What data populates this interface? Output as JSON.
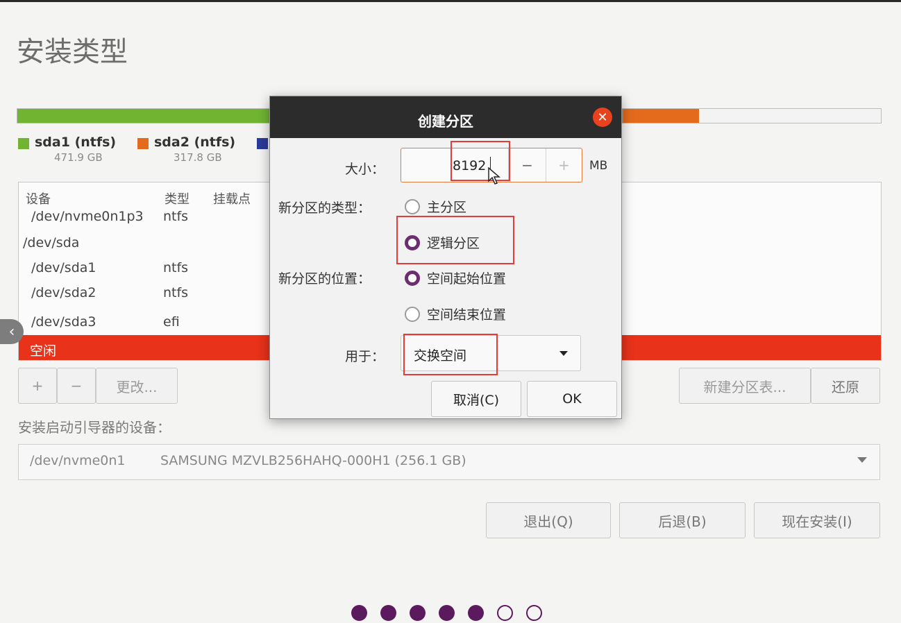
{
  "page": {
    "title": "安装类型"
  },
  "legend": [
    {
      "name": "sda1 (ntfs)",
      "size": "471.9 GB",
      "color": "#71b432"
    },
    {
      "name": "sda2 (ntfs)",
      "size": "317.8 GB",
      "color": "#e46a1c"
    },
    {
      "color": "#2b3b9a"
    }
  ],
  "table": {
    "headers": [
      "设备",
      "类型",
      "挂载点"
    ],
    "rows": [
      {
        "device": "/dev/nvme0n1p3",
        "type": "ntfs"
      },
      {
        "device": "/dev/sda",
        "type": ""
      },
      {
        "device": "/dev/sda1",
        "type": "ntfs"
      },
      {
        "device": "/dev/sda2",
        "type": "ntfs"
      },
      {
        "device": "/dev/sda3",
        "type": "efi"
      }
    ],
    "free_label": "空闲"
  },
  "toolbar": {
    "add": "+",
    "remove": "−",
    "change": "更改...",
    "new_table": "新建分区表...",
    "revert": "还原"
  },
  "boot": {
    "label": "安装启动引导器的设备：",
    "device": "/dev/nvme0n1",
    "model": "SAMSUNG MZVLB256HAHQ-000H1 (256.1 GB)"
  },
  "actions": {
    "quit": "退出(Q)",
    "back": "后退(B)",
    "install": "现在安装(I)"
  },
  "steps": {
    "total": 7,
    "completed": 5
  },
  "dialog": {
    "title": "创建分区",
    "close": "✕",
    "size_label": "大小：",
    "size_value": "8192",
    "size_unit": "MB",
    "minus": "−",
    "plus": "+",
    "type_label": "新分区的类型：",
    "type_primary": "主分区",
    "type_logical": "逻辑分区",
    "location_label": "新分区的位置：",
    "location_start": "空间起始位置",
    "location_end": "空间结束位置",
    "use_label": "用于：",
    "use_value": "交换空间",
    "cancel": "取消(C)",
    "ok": "OK"
  },
  "icons": {
    "close": "close-icon",
    "dropdown": "chevron-down-icon",
    "cursor": "mouse-pointer-icon"
  }
}
